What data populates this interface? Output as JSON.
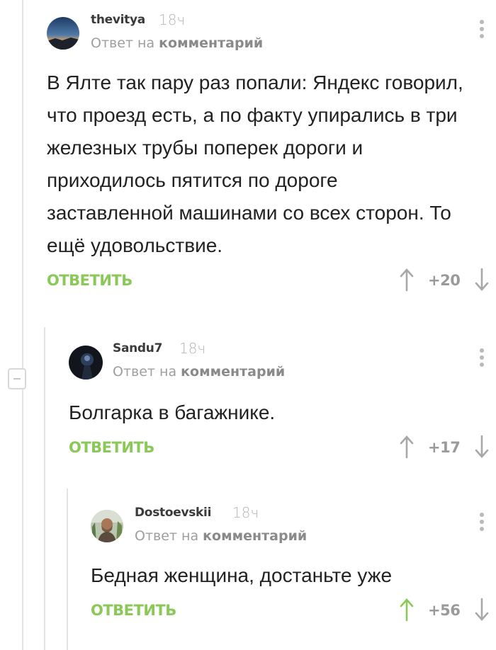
{
  "comments": [
    {
      "username": "thevitya",
      "time": "18ч",
      "reply_prefix": "Ответ на",
      "reply_link": "комментарий",
      "text": "В Ялте так пару раз попали: Яндекс говорил, что проезд есть, а по факту упирались в три железных трубы поперек дороги и приходилось пятится по дороге заставленной машинами со всех сторон. То ещё удовольствие.",
      "reply_label": "ОТВЕТИТЬ",
      "rating": "+20",
      "upvoted": false
    },
    {
      "username": "Sandu7",
      "time": "18ч",
      "reply_prefix": "Ответ на",
      "reply_link": "комментарий",
      "text": "Болгарка в багажнике.",
      "reply_label": "ОТВЕТИТЬ",
      "rating": "+17",
      "upvoted": false
    },
    {
      "username": "Dostoevskii",
      "time": "18ч",
      "reply_prefix": "Ответ на",
      "reply_link": "комментарий",
      "text": "Бедная женщина, достаньте уже",
      "reply_label": "ОТВЕТИТЬ",
      "rating": "+56",
      "upvoted": true
    }
  ],
  "colors": {
    "accent_green": "#8ac858",
    "arrow_grey": "#a8a8a8",
    "thread_line": "#e4e4e4"
  }
}
